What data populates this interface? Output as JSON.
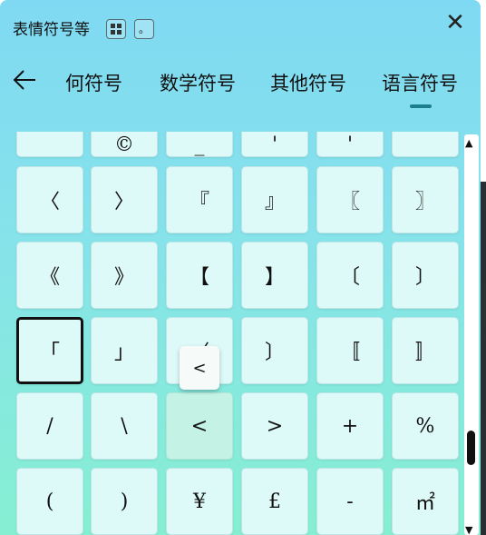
{
  "window": {
    "title": "表情符号等",
    "view_icon": "grid-view-icon",
    "small_button_label": "。",
    "close_label": "✕"
  },
  "nav": {
    "back_icon": "back-arrow-icon",
    "tabs": [
      "何符号",
      "数学符号",
      "其他符号",
      "语言符号"
    ],
    "active_tab": "语言符号"
  },
  "keys": {
    "row0": [
      "",
      "©",
      "_",
      "'",
      "'",
      ""
    ],
    "row1": [
      "〈",
      "〉",
      "『",
      "』",
      "〖",
      "〗"
    ],
    "row2": [
      "《",
      "》",
      "【",
      "】",
      "〔",
      "〕"
    ],
    "row3": [
      "「",
      "」",
      "〈",
      "〕",
      "〚",
      "〛"
    ],
    "row4": [
      "/",
      "\\",
      "<",
      ">",
      "+",
      "%"
    ],
    "row5": [
      "(",
      ")",
      "¥",
      "£",
      "-",
      "㎡"
    ]
  },
  "popup": {
    "char": "<"
  },
  "colors": {
    "accent": "#1a7f8a",
    "gradient_top": "#7fd9f2",
    "gradient_bottom": "#86efd2"
  }
}
